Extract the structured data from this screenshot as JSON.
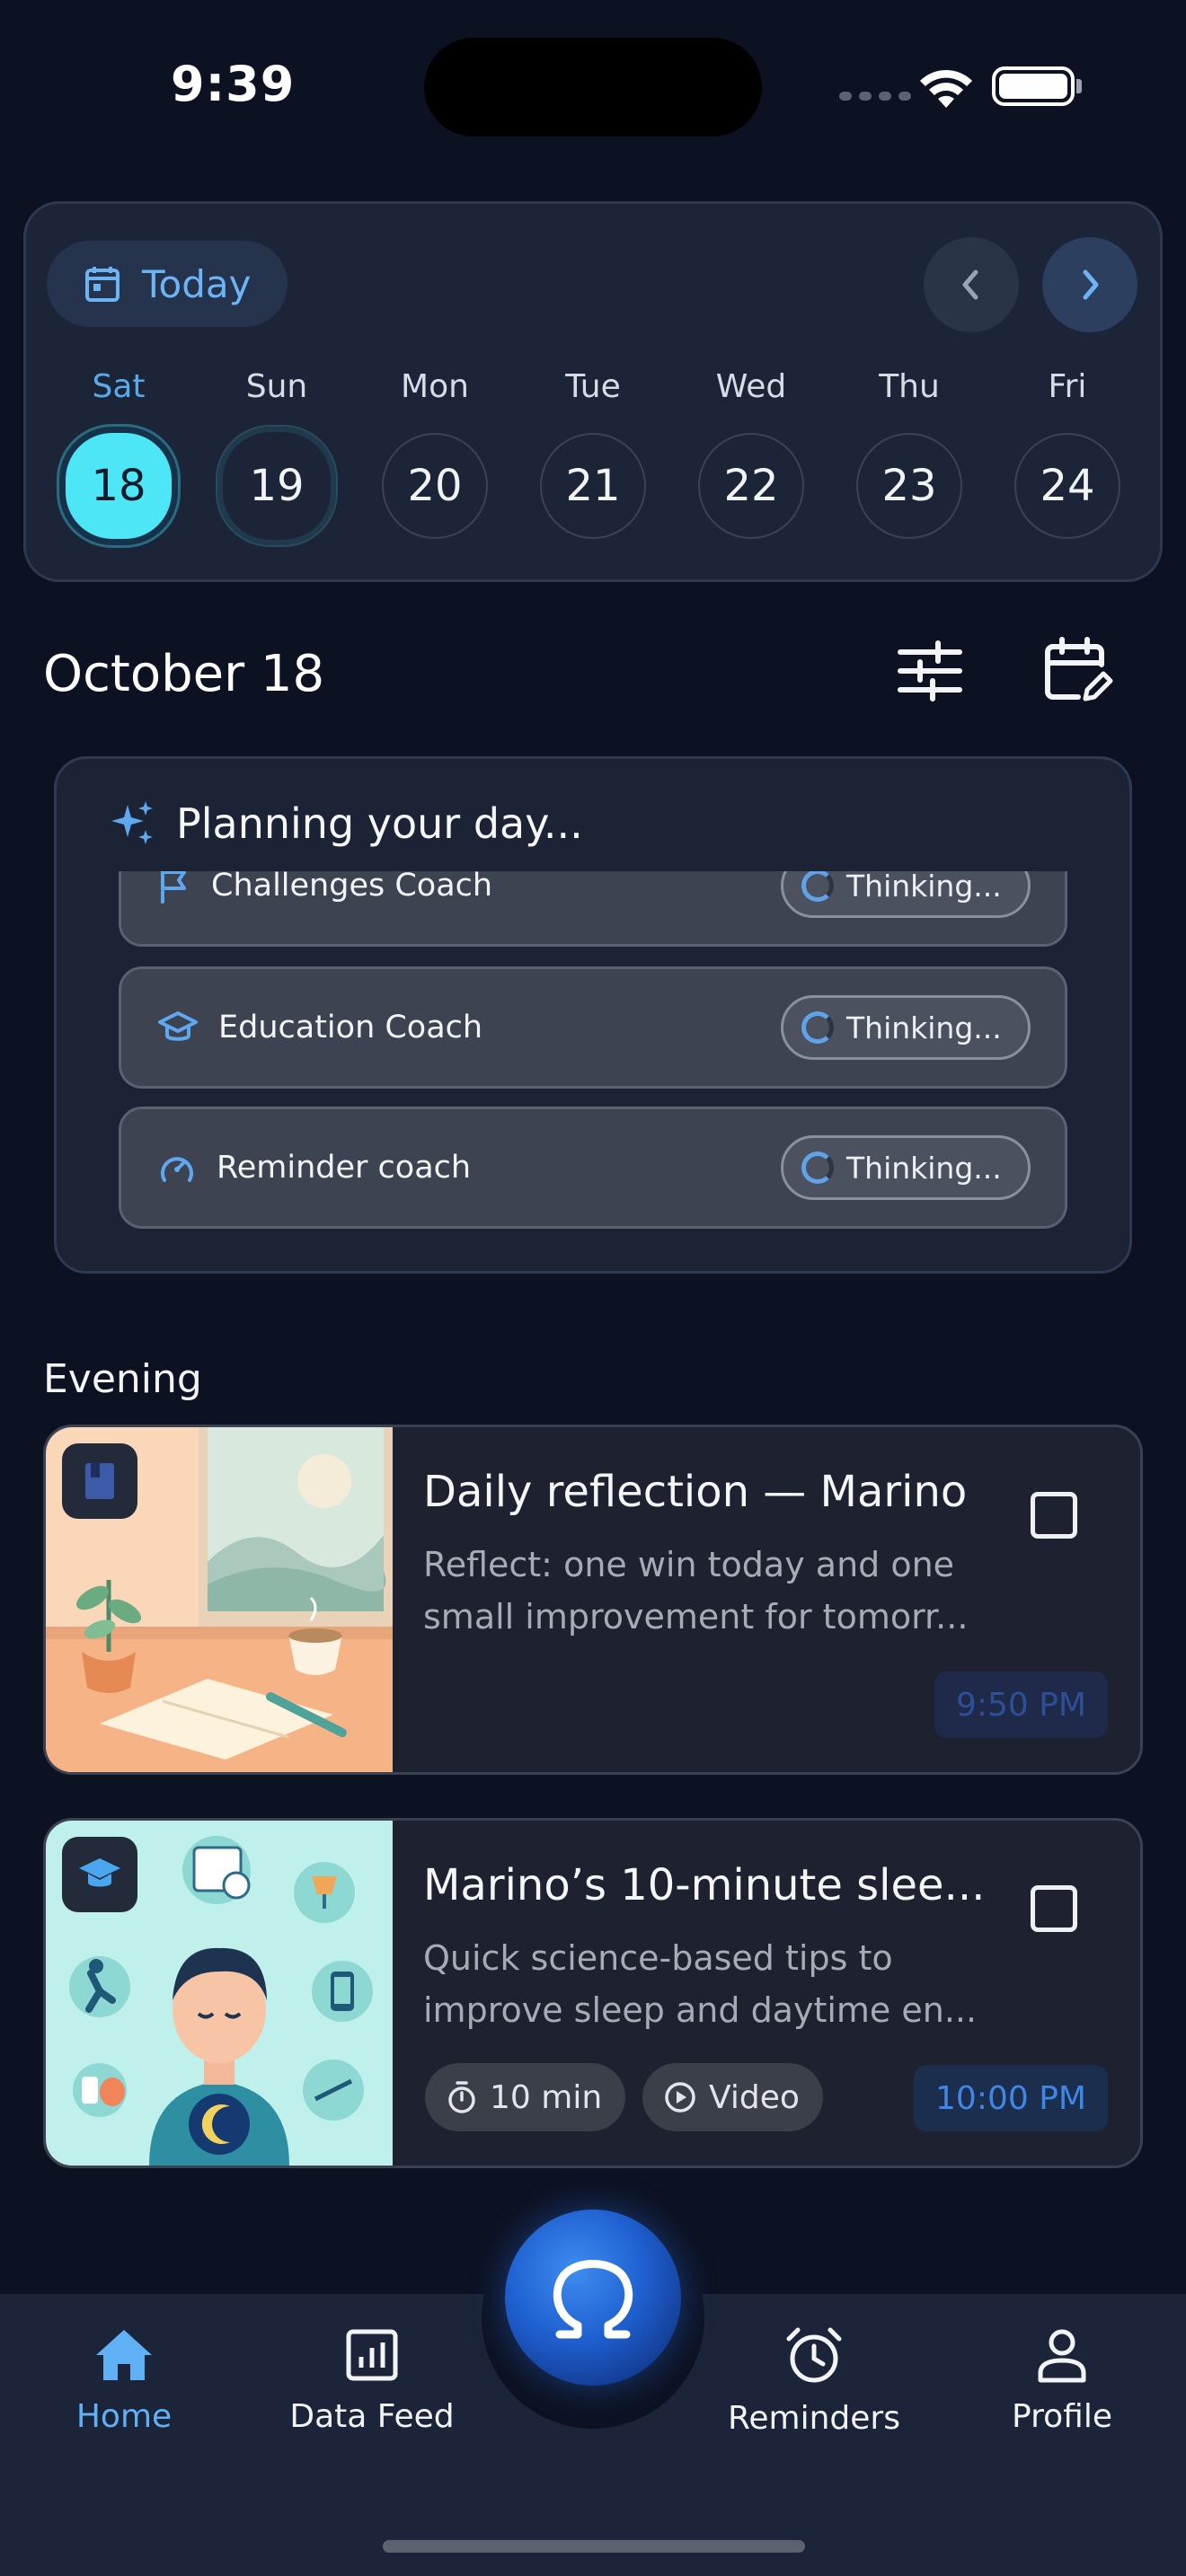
{
  "status_bar": {
    "time": "9:39"
  },
  "calendar": {
    "today_label": "Today",
    "days": [
      {
        "name": "Sat",
        "num": "18",
        "state": "selected"
      },
      {
        "name": "Sun",
        "num": "19",
        "state": "next"
      },
      {
        "name": "Mon",
        "num": "20",
        "state": "normal"
      },
      {
        "name": "Tue",
        "num": "21",
        "state": "normal"
      },
      {
        "name": "Wed",
        "num": "22",
        "state": "normal"
      },
      {
        "name": "Thu",
        "num": "23",
        "state": "normal"
      },
      {
        "name": "Fri",
        "num": "24",
        "state": "normal"
      }
    ]
  },
  "date_header": {
    "title": "October 18"
  },
  "planning": {
    "title": "Planning your day...",
    "coaches": [
      {
        "name": "Challenges Coach",
        "status": "Thinking...",
        "icon": "flag-icon"
      },
      {
        "name": "Education Coach",
        "status": "Thinking...",
        "icon": "graduation-cap-icon"
      },
      {
        "name": "Reminder coach",
        "status": "Thinking...",
        "icon": "reminder-alarm-icon"
      }
    ]
  },
  "section": {
    "title": "Evening"
  },
  "tasks": [
    {
      "title": "Daily reflection — Marino",
      "description": "Reflect: one win today and one small improvement for tomorr...",
      "time": "9:50 PM",
      "badge_icon": "journal-icon"
    },
    {
      "title": "Marino’s 10-minute slee...",
      "description": "Quick science-based tips to improve sleep and daytime en...",
      "duration": "10 min",
      "type": "Video",
      "time": "10:00 PM",
      "badge_icon": "graduation-cap-icon"
    }
  ],
  "bottom_nav": {
    "items": [
      {
        "label": "Home",
        "icon": "home-icon",
        "active": true
      },
      {
        "label": "Data Feed",
        "icon": "bar-chart-icon",
        "active": false
      },
      {
        "label": "Reminders",
        "icon": "alarm-clock-icon",
        "active": false
      },
      {
        "label": "Profile",
        "icon": "person-icon",
        "active": false
      }
    ]
  },
  "colors": {
    "background": "#0d1222",
    "accent": "#5fb0f5",
    "selected_day": "#4de6f6",
    "card": "#1d2130"
  }
}
